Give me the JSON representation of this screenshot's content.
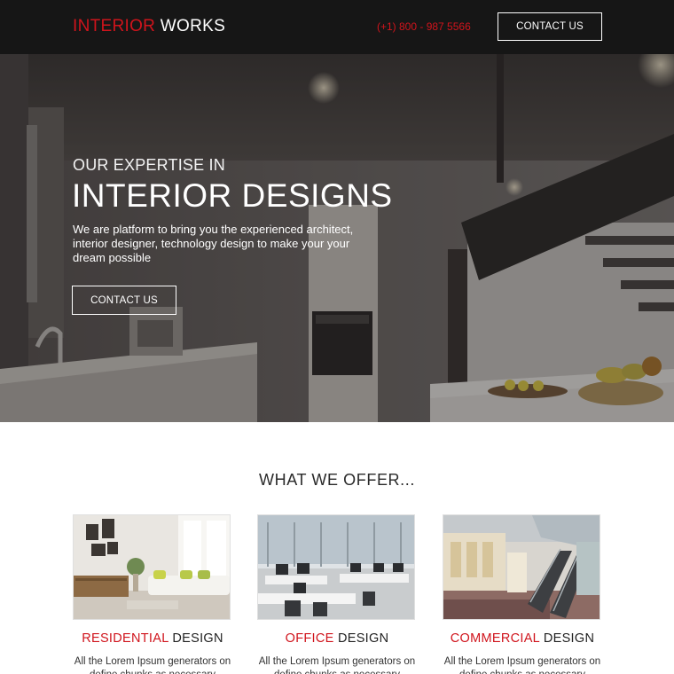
{
  "colors": {
    "accent": "#d0141c",
    "header_bg": "#161616",
    "text_dark": "#222222"
  },
  "header": {
    "logo_accent": "INTERIOR",
    "logo_rest": "WORKS",
    "phone": "(+1) 800 - 987 5566",
    "contact_button": "CONTACT US"
  },
  "hero": {
    "subtitle": "OUR EXPERTISE IN",
    "title": "INTERIOR DESIGNS",
    "description": "We are platform to bring you the experienced architect, interior designer, technology design to make your your dream possible",
    "contact_button": "CONTACT US"
  },
  "offer": {
    "title": "WHAT WE OFFER...",
    "cards": [
      {
        "accent": "RESIDENTIAL",
        "rest": "DESIGN",
        "desc": "All the Lorem Ipsum generators on define chunks as necessary"
      },
      {
        "accent": "OFFICE",
        "rest": "DESIGN",
        "desc": "All the Lorem Ipsum generators on define chunks as necessary"
      },
      {
        "accent": "COMMERCIAL",
        "rest": "DESIGN",
        "desc": "All the Lorem Ipsum generators on define chunks as necessary"
      }
    ]
  }
}
